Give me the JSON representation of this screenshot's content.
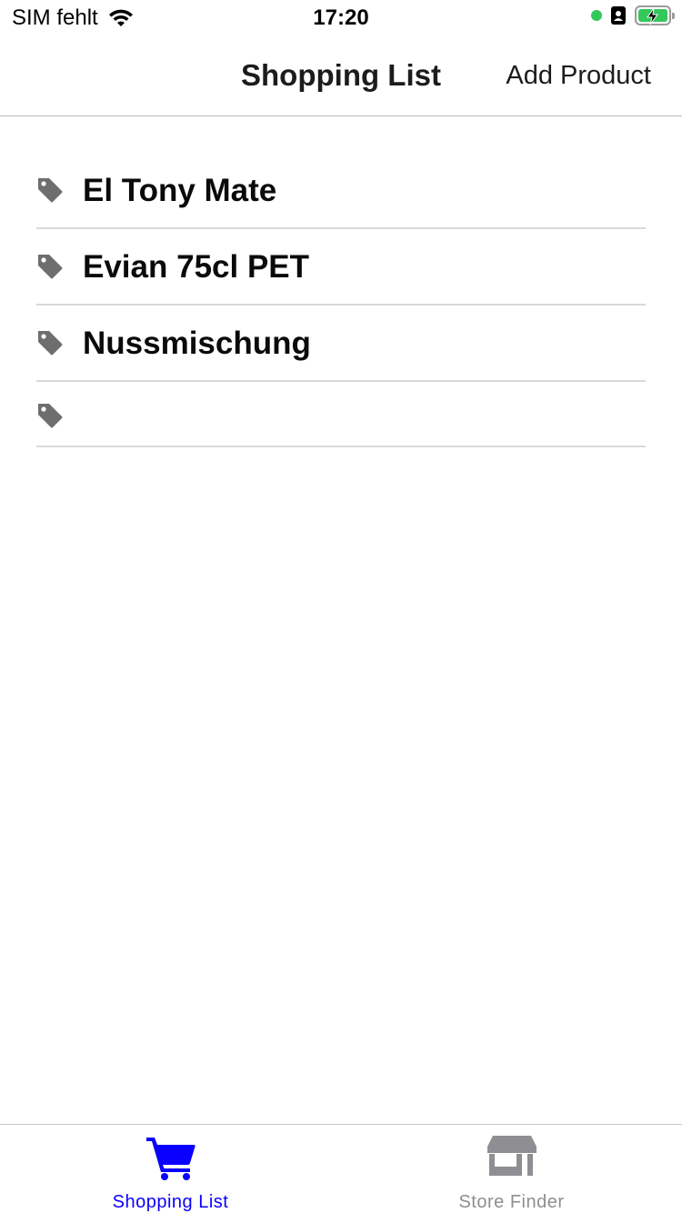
{
  "status_bar": {
    "carrier": "SIM fehlt",
    "time": "17:20",
    "battery_color": "#34c759"
  },
  "nav": {
    "title": "Shopping List",
    "action_label": "Add Product"
  },
  "products": [
    {
      "name": "El Tony Mate",
      "icon": "tag-icon"
    },
    {
      "name": "Evian 75cl PET",
      "icon": "tag-icon"
    },
    {
      "name": "Nussmischung",
      "icon": "tag-icon"
    },
    {
      "name": "",
      "icon": "tag-icon"
    }
  ],
  "tabs": [
    {
      "label": "Shopping List",
      "icon": "cart-icon",
      "active": true,
      "color": "#0a00ff"
    },
    {
      "label": "Store Finder",
      "icon": "store-icon",
      "active": false,
      "color": "#8e8e93"
    }
  ],
  "colors": {
    "accent": "#0a00ff",
    "inactive": "#8e8e93",
    "icon_gray": "#6e6e6e"
  }
}
